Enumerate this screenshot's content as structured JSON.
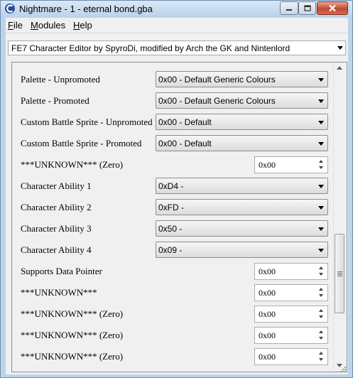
{
  "window": {
    "title": "Nightmare - 1 - eternal bond.gba"
  },
  "menu": [
    {
      "label_u": "F",
      "label_rest": "ile"
    },
    {
      "label_u": "M",
      "label_rest": "odules"
    },
    {
      "label_u": "H",
      "label_rest": "elp"
    }
  ],
  "module_selector": {
    "value": "FE7 Character Editor by SpyroDi, modified by Arch the GK and Nintenlord"
  },
  "fields": [
    {
      "label": "Palette - Unpromoted",
      "type": "dropdown",
      "value": "0x00 - Default Generic Colours"
    },
    {
      "label": "Palette - Promoted",
      "type": "dropdown",
      "value": "0x00 - Default Generic Colours"
    },
    {
      "label": "Custom Battle Sprite - Unpromoted",
      "type": "dropdown",
      "value": "0x00 - Default"
    },
    {
      "label": "Custom Battle Sprite - Promoted",
      "type": "dropdown",
      "value": "0x00 - Default"
    },
    {
      "label": "***UNKNOWN*** (Zero)",
      "type": "number",
      "value": "0x00"
    },
    {
      "label": "Character Ability 1",
      "type": "dropdown",
      "value": "0xD4 -"
    },
    {
      "label": "Character Ability 2",
      "type": "dropdown",
      "value": "0xFD -"
    },
    {
      "label": "Character Ability 3",
      "type": "dropdown",
      "value": "0x50 -"
    },
    {
      "label": "Character Ability 4",
      "type": "dropdown",
      "value": "0x09 -"
    },
    {
      "label": "Supports Data Pointer",
      "type": "number",
      "value": "0x00"
    },
    {
      "label": "***UNKNOWN***",
      "type": "number",
      "value": "0x00"
    },
    {
      "label": "***UNKNOWN*** (Zero)",
      "type": "number",
      "value": "0x00"
    },
    {
      "label": "***UNKNOWN*** (Zero)",
      "type": "number",
      "value": "0x00"
    },
    {
      "label": "***UNKNOWN*** (Zero)",
      "type": "number",
      "value": "0x00"
    }
  ],
  "scrollbar": {
    "position_fraction": 0.78,
    "thumb_fraction": 0.28
  }
}
